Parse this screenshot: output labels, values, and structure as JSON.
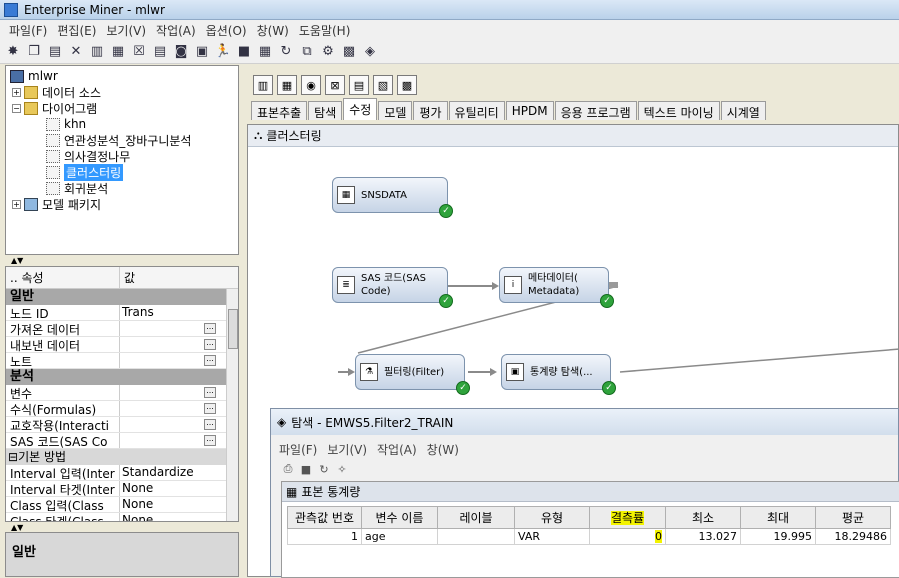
{
  "window": {
    "title": "Enterprise Miner - mlwr"
  },
  "menu": [
    "파일(F)",
    "편집(E)",
    "보기(V)",
    "작업(A)",
    "옵션(O)",
    "창(W)",
    "도움말(H)"
  ],
  "tree": {
    "root": "mlwr",
    "data_source": "데이터 소스",
    "diagrams": "다이어그램",
    "items": [
      "khn",
      "연관성분석_장바구니분석",
      "의사결정나무",
      "클러스터링",
      "회귀분석"
    ],
    "model_package": "모델 패키지"
  },
  "props": {
    "col_name": ".. 속성",
    "col_value": "값",
    "section_general": "일반",
    "rows_general": [
      {
        "name": "노드 ID",
        "value": "Trans"
      },
      {
        "name": "가져온 데이터",
        "value": ""
      },
      {
        "name": "내보낸 데이터",
        "value": ""
      },
      {
        "name": "노트",
        "value": ""
      }
    ],
    "section_analysis": "분석",
    "rows_analysis": [
      {
        "name": "변수",
        "value": ""
      },
      {
        "name": "수식(Formulas)",
        "value": ""
      },
      {
        "name": "교호작용(Interacti",
        "value": ""
      },
      {
        "name": "SAS 코드(SAS Co",
        "value": ""
      }
    ],
    "sub_basic": "기본 방법",
    "rows_basic": [
      {
        "name": "Interval 입력(Inter",
        "value": "Standardize"
      },
      {
        "name": "Interval 타겟(Inter",
        "value": "None"
      },
      {
        "name": "Class 입력(Class",
        "value": "None"
      },
      {
        "name": "Class 타겟(Class",
        "value": "None"
      }
    ],
    "description_title": "일반"
  },
  "tabs": [
    "표본추출",
    "탐색",
    "수정",
    "모델",
    "평가",
    "유틸리티",
    "HPDM",
    "응용 프로그램",
    "텍스트 마이닝",
    "시계열"
  ],
  "active_tab": "수정",
  "diagram": {
    "title": "클러스터링",
    "nodes": {
      "snsdata": {
        "line1": "SNSDATA",
        "line2": ""
      },
      "sascode": {
        "line1": "SAS 코드(SAS",
        "line2": "Code)"
      },
      "metadata": {
        "line1": "메타데이터(",
        "line2": "Metadata)"
      },
      "filter": {
        "line1": "필터링(Filter)",
        "line2": ""
      },
      "statexplore": {
        "line1": "통계량 탐색(...",
        "line2": ""
      }
    }
  },
  "explore": {
    "title": "탐색 - EMWS5.Filter2_TRAIN",
    "menu": [
      "파일(F)",
      "보기(V)",
      "작업(A)",
      "창(W)"
    ],
    "panel_title": "표본 통계량",
    "headers": [
      "관측값 번호",
      "변수 이름",
      "레이블",
      "유형",
      "결측률",
      "최소",
      "최대",
      "평균"
    ],
    "rows": [
      [
        "1",
        "age",
        "",
        "VAR",
        "0",
        "13.027",
        "19.995",
        "18.29486"
      ]
    ]
  }
}
